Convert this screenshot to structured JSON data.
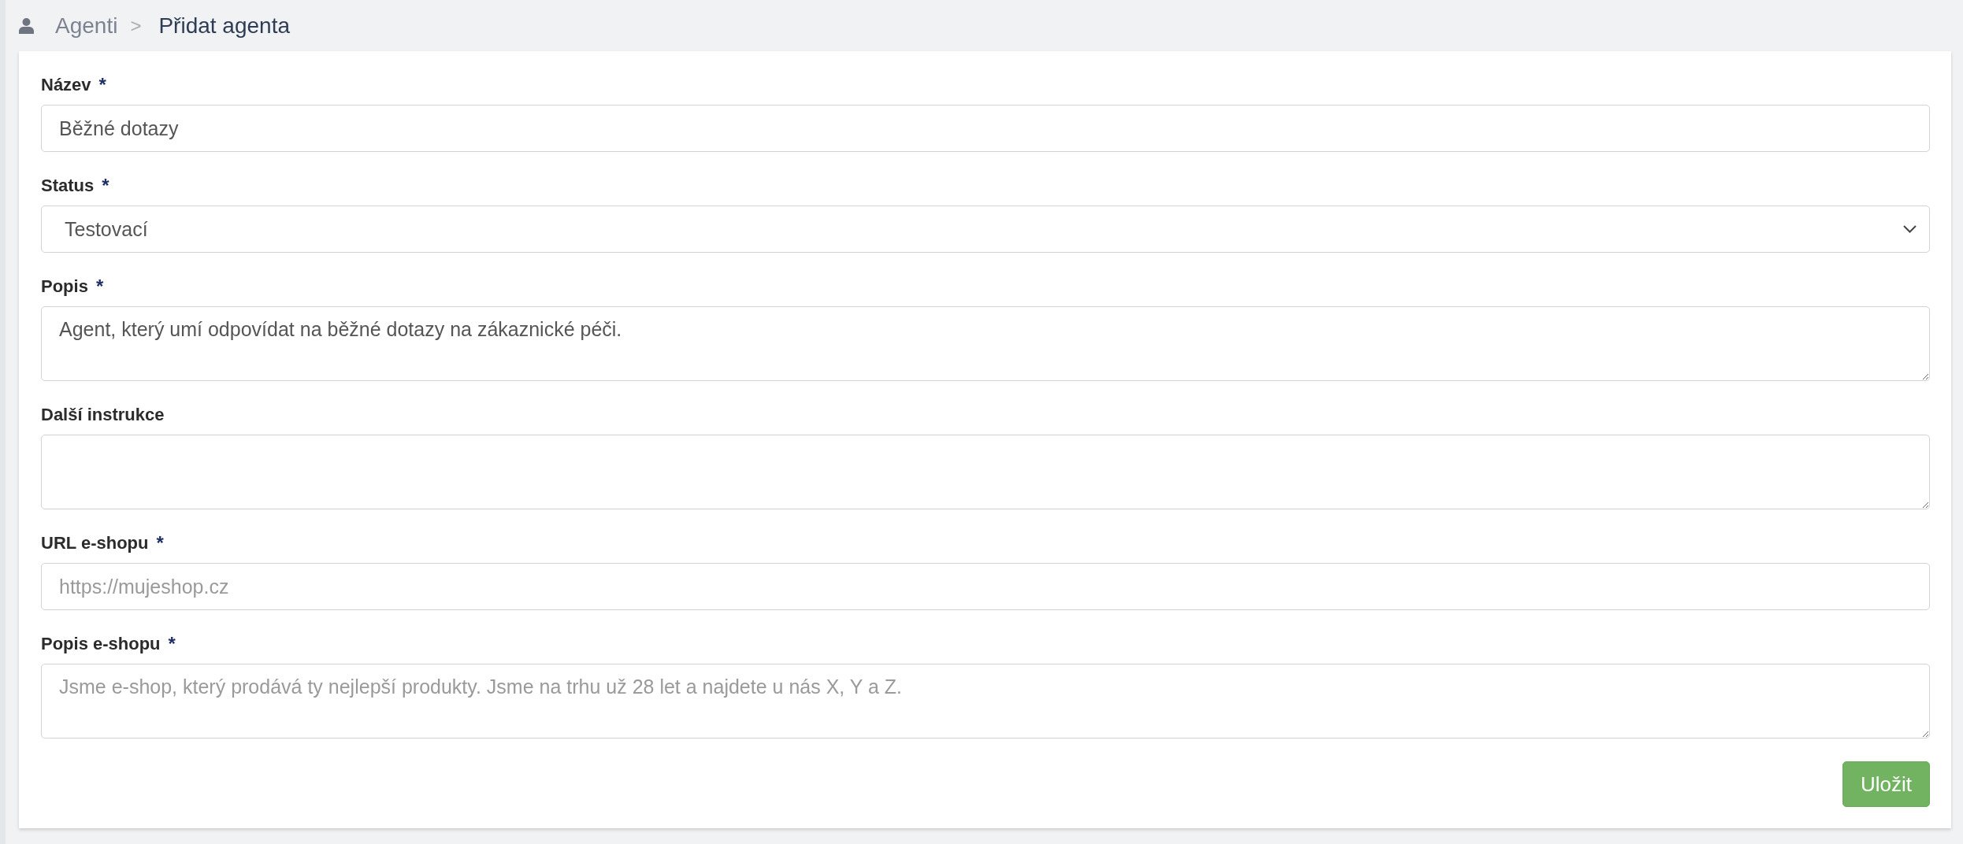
{
  "breadcrumb": {
    "separator": ">",
    "items": [
      {
        "label": "Agenti",
        "current": false
      },
      {
        "label": "Přidat agenta",
        "current": true
      }
    ]
  },
  "form": {
    "fields": [
      {
        "kind": "input",
        "label": "Název",
        "required_mark": "*",
        "value": "Běžné dotazy"
      },
      {
        "kind": "select",
        "label": "Status",
        "required_mark": "*",
        "value": "Testovací"
      },
      {
        "kind": "textarea",
        "label": "Popis",
        "required_mark": "*",
        "value": "Agent, který umí odpovídat na běžné dotazy na zákaznické péči."
      },
      {
        "kind": "textarea",
        "label": "Další instrukce"
      },
      {
        "kind": "input",
        "label": "URL e-shopu",
        "required_mark": "*",
        "placeholder": "https://mujeshop.cz"
      },
      {
        "kind": "textarea",
        "label": "Popis e-shopu",
        "required_mark": "*",
        "placeholder": "Jsme e-shop, který prodává ty nejlepší produkty. Jsme na trhu už 28 let a najdete u nás X, Y a Z."
      }
    ],
    "submit": {
      "label": "Uložit"
    }
  }
}
